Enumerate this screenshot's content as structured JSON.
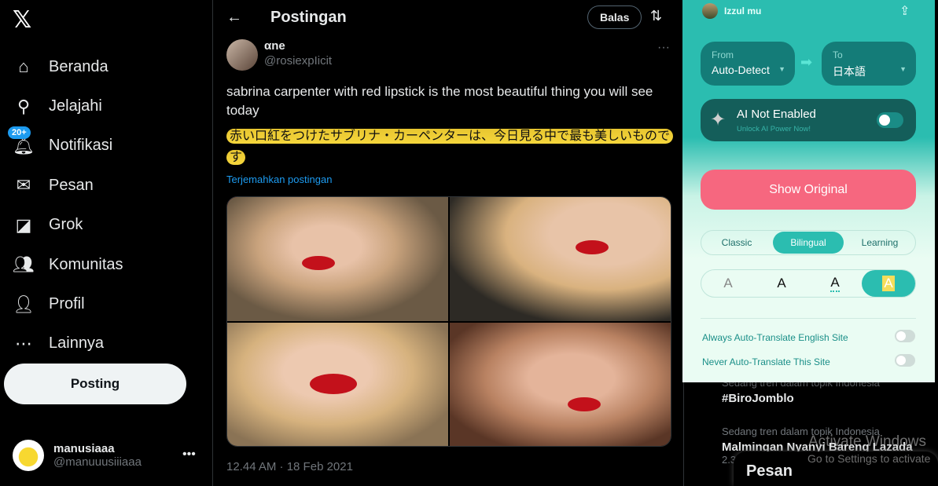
{
  "sidebar": {
    "logo": "𝕏",
    "items": [
      {
        "icon": "home-icon",
        "glyph": "⌂",
        "label": "Beranda"
      },
      {
        "icon": "search-icon",
        "glyph": "⚲",
        "label": "Jelajahi"
      },
      {
        "icon": "bell-icon",
        "glyph": "🔔︎",
        "label": "Notifikasi",
        "badge": "20+"
      },
      {
        "icon": "mail-icon",
        "glyph": "✉",
        "label": "Pesan"
      },
      {
        "icon": "grok-icon",
        "glyph": "◪",
        "label": "Grok"
      },
      {
        "icon": "communities-icon",
        "glyph": "👥︎",
        "label": "Komunitas"
      },
      {
        "icon": "profile-icon",
        "glyph": "👤︎",
        "label": "Profil"
      },
      {
        "icon": "more-icon",
        "glyph": "⋯",
        "label": "Lainnya"
      }
    ],
    "post_button": "Posting",
    "user": {
      "name": "manusiaaa",
      "handle": "@manuuusiiiaaa"
    }
  },
  "header": {
    "title": "Postingan",
    "reply_button": "Balas"
  },
  "tweet": {
    "author": "αne",
    "handle": "@rosiexpIicit",
    "text": "sabrina carpenter with red lipstick is the most beautiful thing you will see today",
    "translation": "赤い口紅をつけたサブリナ・カーペンターは、今日見る中で最も美しいものです",
    "translate_link": "Terjemahkan postingan",
    "timestamp": "12.44 AM · 18 Feb 2021"
  },
  "trends": [
    {
      "context": "Sedang tren dalam topik Indonesia",
      "name": "#BiroJomblo"
    },
    {
      "context": "Sedang tren dalam topik Indonesia",
      "name": "Malmingan Nyanyi Bareng Lazada",
      "count": "2.3"
    }
  ],
  "dm_drawer": {
    "title": "Pesan"
  },
  "watermark": {
    "line1": "Activate Windows",
    "line2": "Go to Settings to activate"
  },
  "translator": {
    "user": "Izzul mu",
    "from": {
      "label": "From",
      "value": "Auto-Detect"
    },
    "to": {
      "label": "To",
      "value": "日本語"
    },
    "ai": {
      "title": "AI Not Enabled",
      "subtitle": "Unlock AI Power Now!",
      "enabled": false
    },
    "show_original": "Show Original",
    "modes": [
      "Classic",
      "Bilingual",
      "Learning"
    ],
    "active_mode": "Bilingual",
    "styles": [
      "A",
      "A",
      "A",
      "A"
    ],
    "options": [
      {
        "label": "Always Auto-Translate English Site",
        "enabled": false
      },
      {
        "label": "Never Auto-Translate This Site",
        "enabled": false
      }
    ],
    "colors": {
      "accent": "#2bbdb0",
      "button": "#f6677f"
    }
  }
}
